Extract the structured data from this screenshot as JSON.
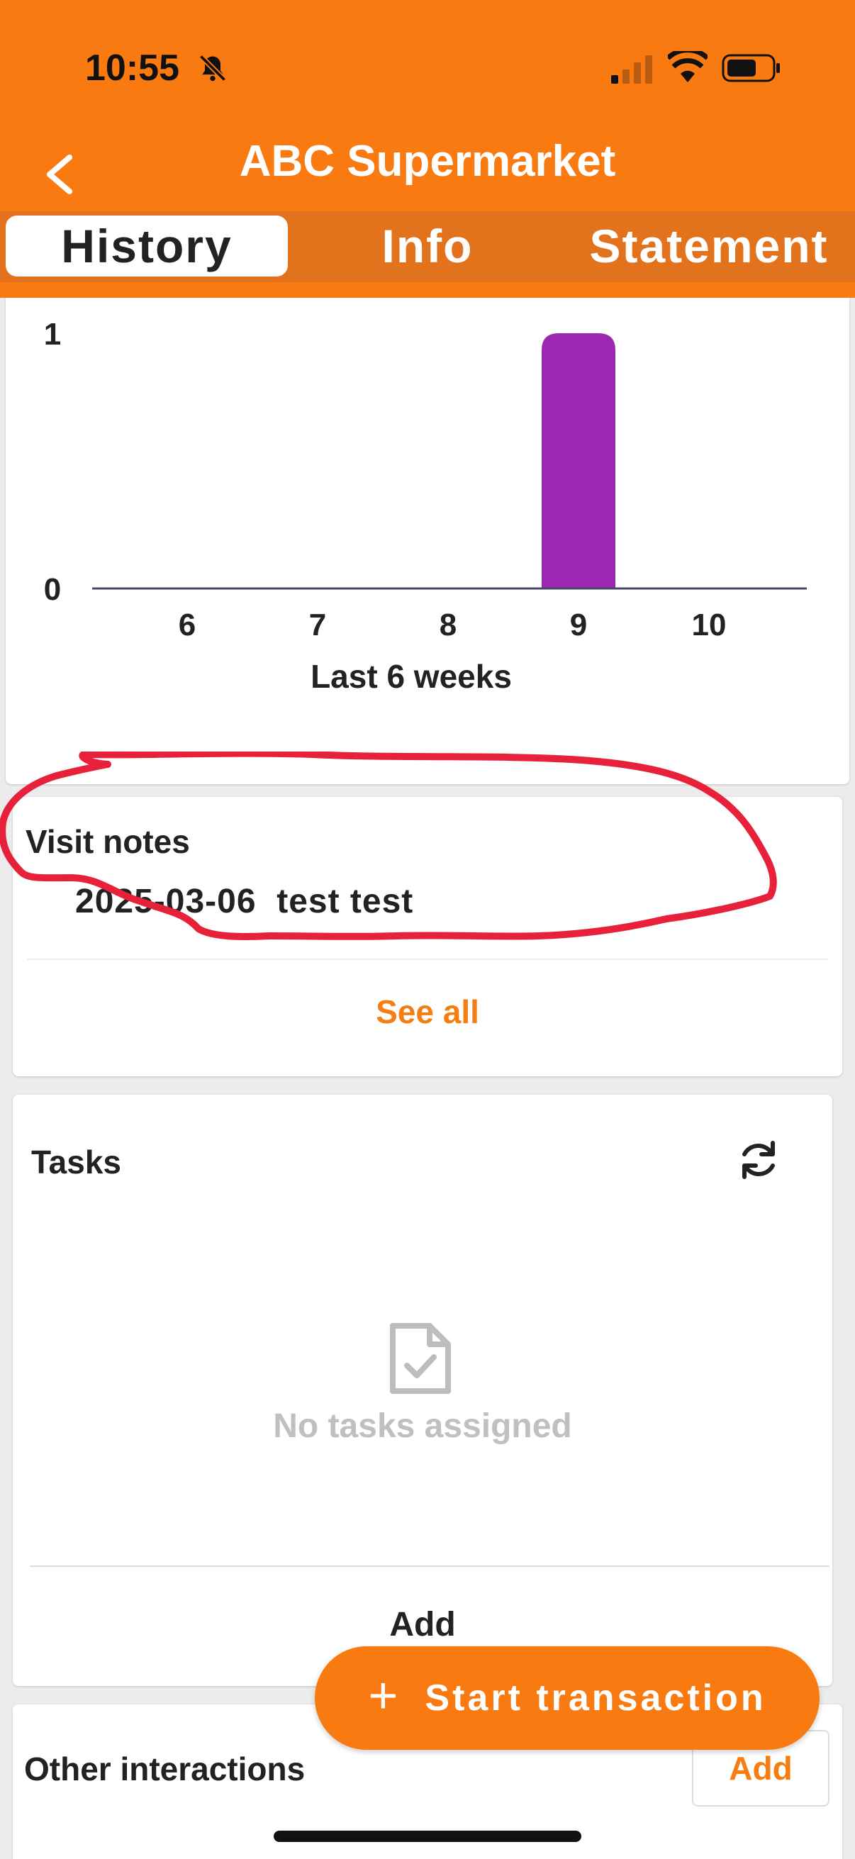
{
  "status_bar": {
    "time": "10:55"
  },
  "header": {
    "title": "ABC Supermarket"
  },
  "tabs": [
    {
      "label": "History",
      "active": true
    },
    {
      "label": "Info",
      "active": false
    },
    {
      "label": "Statement",
      "active": false
    }
  ],
  "chart_data": {
    "type": "bar",
    "categories": [
      "6",
      "7",
      "8",
      "9",
      "10"
    ],
    "values": [
      0,
      0,
      0,
      1,
      0
    ],
    "xlabel": "Last 6 weeks",
    "ylabel": "",
    "ylim": [
      0,
      1
    ],
    "yticks": [
      "0",
      "1"
    ],
    "bar_color": "#9c27b0",
    "grid": false
  },
  "visit_notes": {
    "title": "Visit notes",
    "entries": [
      {
        "date": "2025-03-06",
        "text": "test test"
      }
    ],
    "see_all_label": "See all"
  },
  "tasks": {
    "title": "Tasks",
    "empty_text": "No tasks assigned",
    "add_label": "Add"
  },
  "other_interactions": {
    "title": "Other interactions",
    "add_label": "Add"
  },
  "fab": {
    "label": "Start transaction"
  },
  "colors": {
    "accent": "#fa7a12",
    "tab_bar": "#e2731c",
    "bar": "#9c27b0",
    "annotation": "#e8213a"
  },
  "icons": {
    "back": "chevron-left-icon",
    "refresh": "refresh-icon",
    "empty_tasks": "document-check-icon",
    "fab": "plus-icon"
  }
}
